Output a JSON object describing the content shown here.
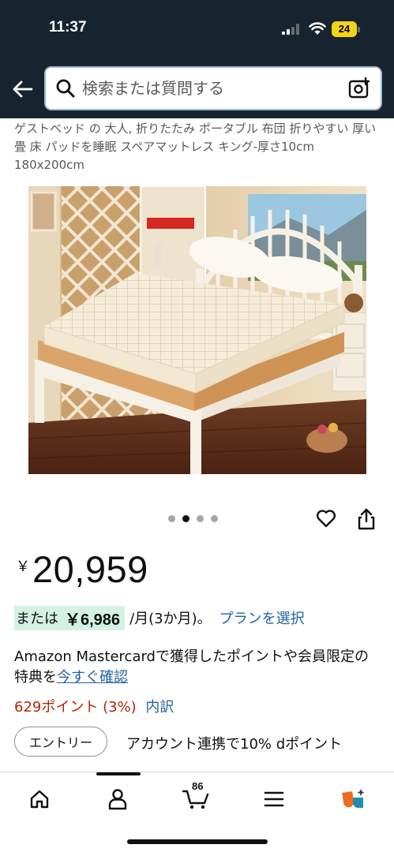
{
  "status_bar": {
    "time": "11:37",
    "battery": "24"
  },
  "search": {
    "placeholder": "検索または質問する"
  },
  "product": {
    "title": "ゲストベッド の 大人, 折りたたみ ポータブル 布団 折りやすい 厚い 畳 床 パッドを睡眠 スペアマットレス キング-厚さ10cm 180x200cm",
    "image_count": 4,
    "active_image_index": 1,
    "currency_symbol": "￥",
    "price": "20,959",
    "installment": {
      "prefix": "または",
      "amount": "￥6,986",
      "period": "/月(3か月)。",
      "plan_link": "プランを選択"
    },
    "mastercard_text": "Amazon Mastercardで獲得したポイントや会員限定の特典を",
    "mastercard_link": "今すぐ確認",
    "points": "629ポイント (3%)",
    "points_link": "内訳",
    "entry_button": "エントリー",
    "entry_desc": "アカウント連携で10% dポイント"
  },
  "bottom_nav": {
    "cart_count": "86"
  },
  "colors": {
    "header_bg": "#172430",
    "link": "#2162a1",
    "points_red": "#b12704",
    "installment_highlight": "#d4f2e4"
  }
}
